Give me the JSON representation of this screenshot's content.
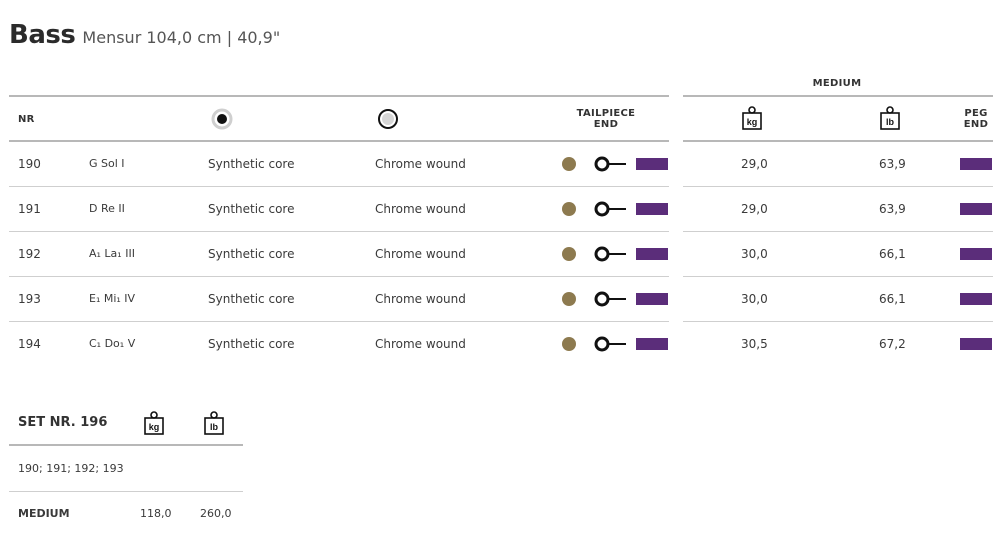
{
  "header": {
    "title": "Bass",
    "subtitle": "Mensur 104,0 cm | 40,9\""
  },
  "table": {
    "group_label": "MEDIUM",
    "columns": {
      "nr": "NR",
      "tailpiece_line1": "TAILPIECE",
      "tailpiece_line2": "END",
      "peg_line1": "PEG",
      "peg_line2": "END"
    },
    "icon_labels": {
      "kg": "kg",
      "lb": "lb"
    },
    "rows": [
      {
        "nr": "190",
        "note": "G  Sol  I",
        "core": "Synthetic core",
        "winding": "Chrome wound",
        "kg": "29,0",
        "lb": "63,9"
      },
      {
        "nr": "191",
        "note": "D  Re  II",
        "core": "Synthetic core",
        "winding": "Chrome wound",
        "kg": "29,0",
        "lb": "63,9"
      },
      {
        "nr": "192",
        "note": "A₁  La₁  III",
        "core": "Synthetic core",
        "winding": "Chrome wound",
        "kg": "30,0",
        "lb": "66,1"
      },
      {
        "nr": "193",
        "note": "E₁  Mi₁  IV",
        "core": "Synthetic core",
        "winding": "Chrome wound",
        "kg": "30,0",
        "lb": "66,1"
      },
      {
        "nr": "194",
        "note": "C₁  Do₁  V",
        "core": "Synthetic core",
        "winding": "Chrome wound",
        "kg": "30,5",
        "lb": "67,2"
      }
    ],
    "colors": {
      "olive_dot": "#8d7a4f",
      "purple_bar": "#5b2d7a"
    }
  },
  "set": {
    "title": "SET NR. 196",
    "strings": "190; 191; 192; 193",
    "tension_label": "MEDIUM",
    "kg": "118,0",
    "lb": "260,0"
  }
}
